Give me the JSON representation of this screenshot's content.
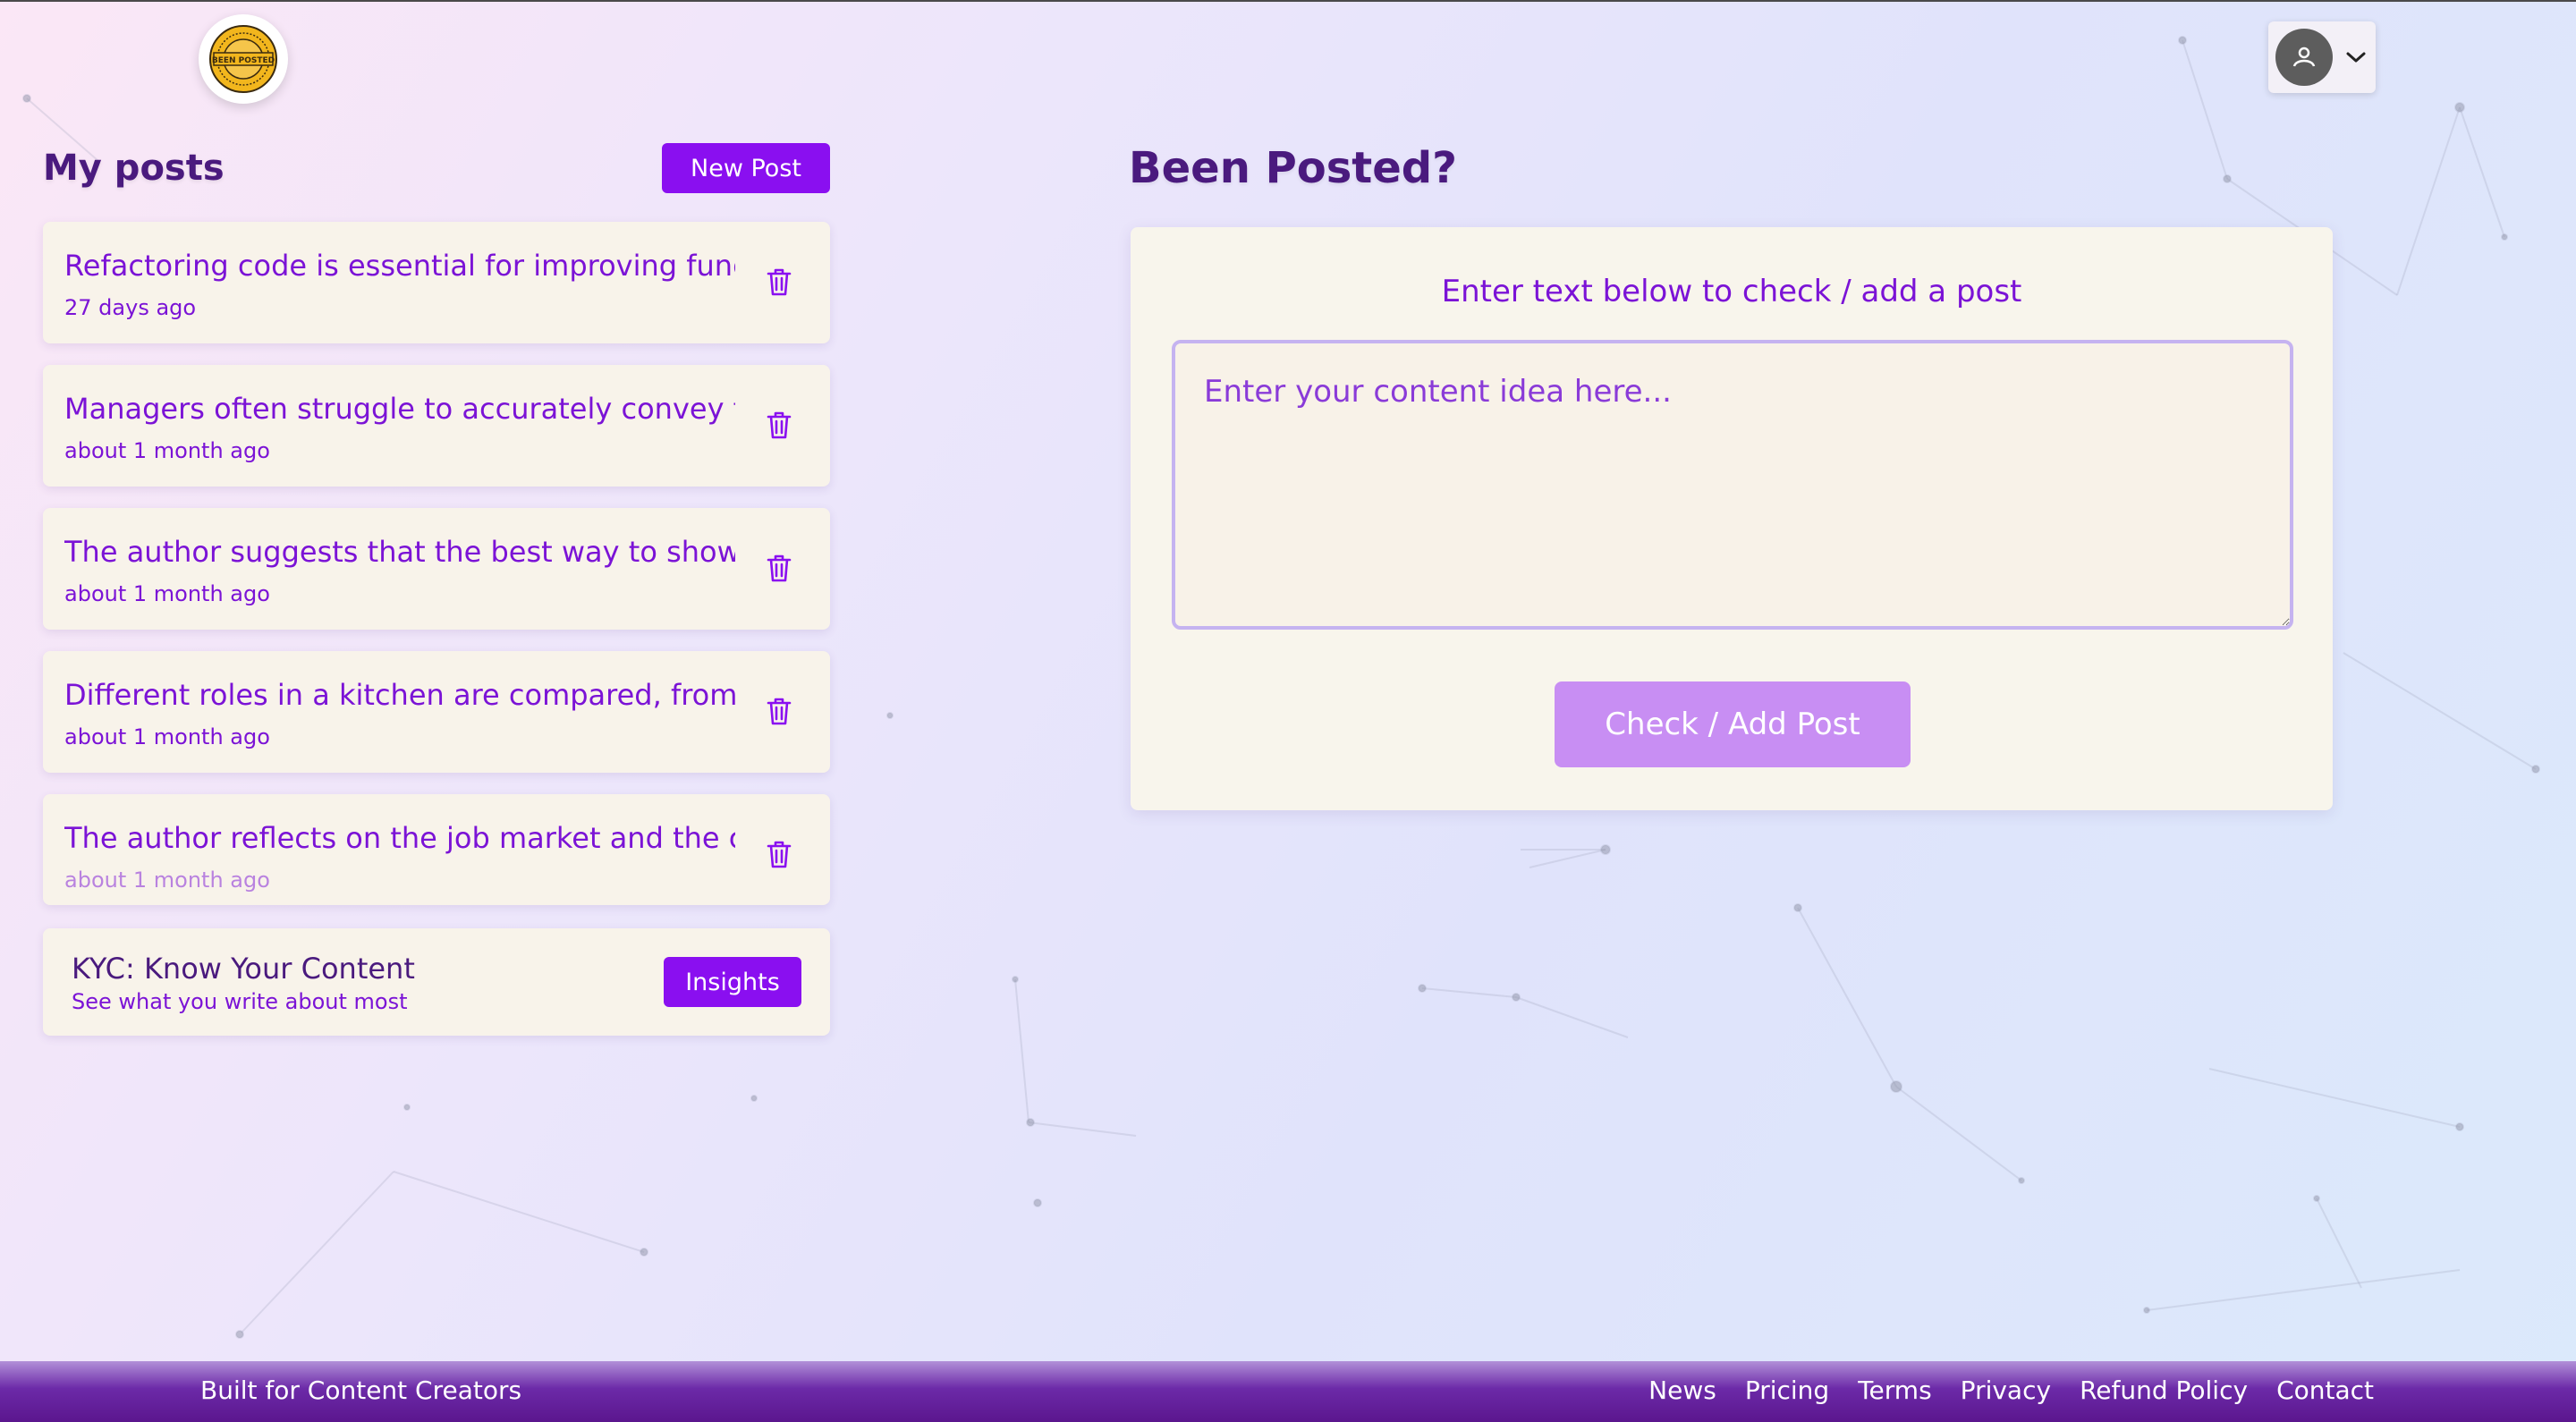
{
  "header": {
    "logo_text": "BEEN POSTED"
  },
  "sidebar": {
    "title": "My posts",
    "new_post_label": "New Post",
    "posts": [
      {
        "title": "Refactoring code is essential for improving functionality",
        "time": "27 days ago"
      },
      {
        "title": "Managers often struggle to accurately convey the",
        "time": "about 1 month ago"
      },
      {
        "title": "The author suggests that the best way to showcase",
        "time": "about 1 month ago"
      },
      {
        "title": "Different roles in a kitchen are compared, from a",
        "time": "about 1 month ago"
      },
      {
        "title": "The author reflects on the job market and the changes",
        "time": "about 1 month ago"
      }
    ],
    "kyc": {
      "title": "KYC: Know Your Content",
      "subtitle": "See what you write about most",
      "button_label": "Insights"
    }
  },
  "main": {
    "title": "Been Posted?",
    "prompt": "Enter text below to check / add a post",
    "textarea_placeholder": "Enter your content idea here...",
    "textarea_value": "",
    "submit_label": "Check / Add Post"
  },
  "footer": {
    "tagline": "Built for Content Creators",
    "links": [
      "News",
      "Pricing",
      "Terms",
      "Privacy",
      "Refund Policy",
      "Contact"
    ]
  },
  "colors": {
    "accent": "#8a0ff0",
    "text_purple": "#7b13d6",
    "heading": "#4a1a7e",
    "submit_disabled": "#c88ef3",
    "footer": "#5b168e"
  }
}
